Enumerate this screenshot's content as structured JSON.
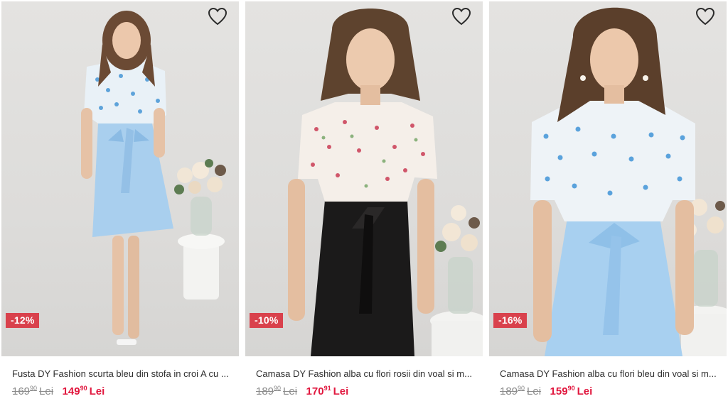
{
  "products": [
    {
      "title": "Fusta DY Fashion scurta bleu din stofa in croi A cu ...",
      "discount": "-12%",
      "old_price_int": "169",
      "old_price_dec": "90",
      "new_price_int": "149",
      "new_price_dec": "90",
      "currency": "Lei",
      "wishlist_icon": "heart-outline-icon",
      "image_alt": "Model in blue floral blouse and light blue A-line skirt"
    },
    {
      "title": "Camasa DY Fashion alba cu flori rosii din voal si m...",
      "discount": "-10%",
      "old_price_int": "189",
      "old_price_dec": "90",
      "new_price_int": "170",
      "new_price_dec": "91",
      "currency": "Lei",
      "wishlist_icon": "heart-outline-icon",
      "image_alt": "Model in white blouse with red flowers and black skirt"
    },
    {
      "title": "Camasa DY Fashion alba cu flori bleu din voal si m...",
      "discount": "-16%",
      "old_price_int": "189",
      "old_price_dec": "90",
      "new_price_int": "159",
      "new_price_dec": "90",
      "currency": "Lei",
      "wishlist_icon": "heart-outline-icon",
      "image_alt": "Model in white blouse with blue flowers and light blue skirt"
    }
  ],
  "colors": {
    "badge": "#d9414c",
    "new_price": "#e1173e",
    "old_price": "#8a8a8a",
    "photo_bg": "#e0dfdd"
  }
}
